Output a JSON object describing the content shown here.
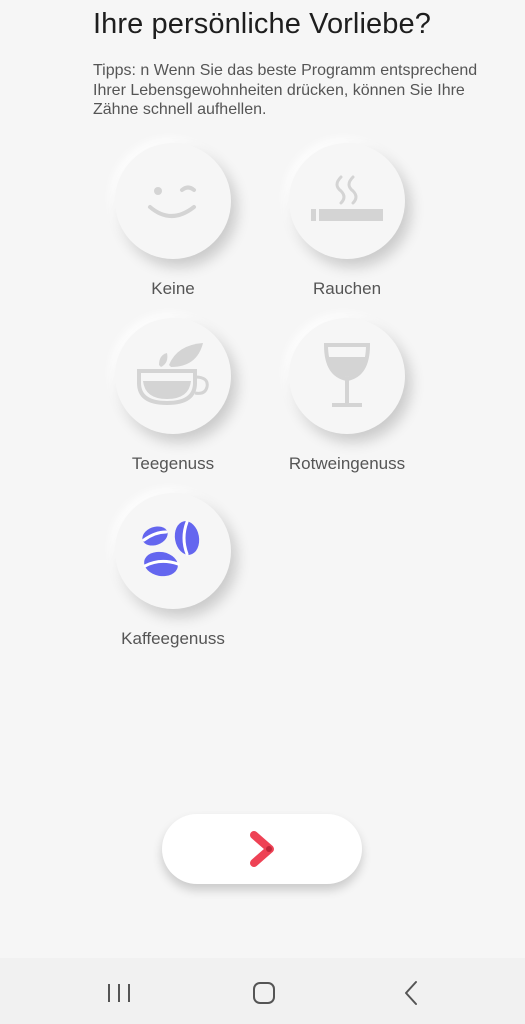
{
  "header": {
    "title": "Ihre persönliche Vorliebe?",
    "tip": "Tipps:  n Wenn Sie das beste Programm entsprechend Ihrer Lebensgewohnheiten drücken, können Sie Ihre Zähne schnell aufhellen."
  },
  "options": [
    {
      "label": "Keine",
      "icon": "smiley-wink-icon",
      "selected": false
    },
    {
      "label": "Rauchen",
      "icon": "cigarette-icon",
      "selected": false
    },
    {
      "label": "Teegenuss",
      "icon": "tea-cup-icon",
      "selected": false
    },
    {
      "label": "Rotweingenuss",
      "icon": "wine-glass-icon",
      "selected": false
    },
    {
      "label": "Kaffeegenuss",
      "icon": "coffee-beans-icon",
      "selected": true
    }
  ],
  "next_button": {
    "icon": "chevron-right-icon"
  },
  "navbar": {
    "recent_icon": "recent-apps-icon",
    "home_icon": "home-icon",
    "back_icon": "back-icon"
  },
  "colors": {
    "background": "#f6f6f6",
    "icon_inactive": "#d4d4d4",
    "icon_selected": "#6466ef",
    "next_arrow": "#ee4255",
    "text": "#555555"
  }
}
